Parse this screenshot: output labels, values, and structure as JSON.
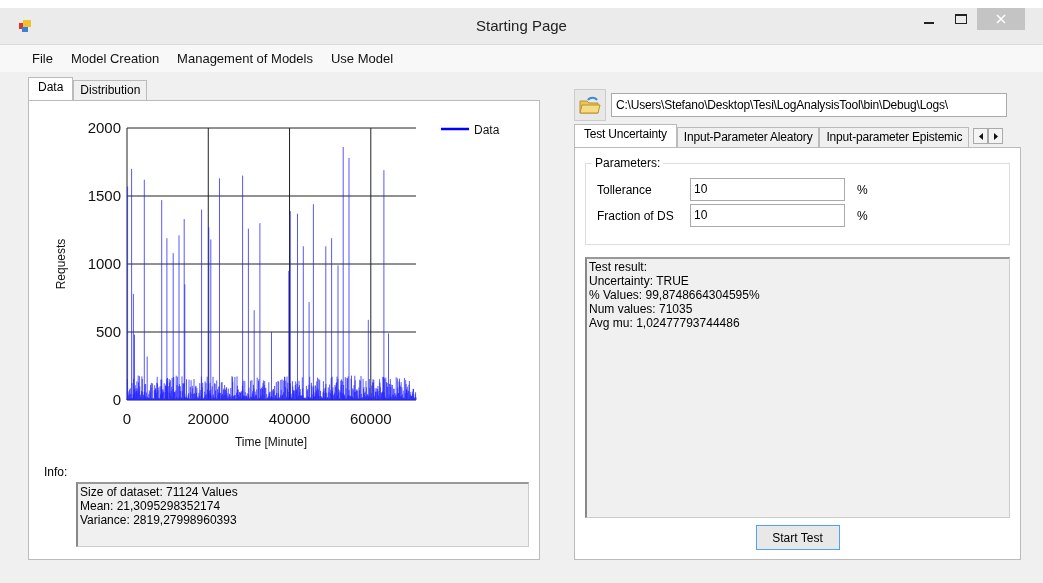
{
  "window": {
    "title": "Starting Page"
  },
  "menu": [
    {
      "label": "File"
    },
    {
      "label": "Model Creation"
    },
    {
      "label": "Management of Models"
    },
    {
      "label": "Use Model"
    }
  ],
  "left_tabs": [
    {
      "label": "Data",
      "selected": true
    },
    {
      "label": "Distribution",
      "selected": false
    }
  ],
  "chart": {
    "ylabel": "Requests",
    "xlabel": "Time [Minute]",
    "yticks": [
      "2000",
      "1500",
      "1000",
      "500",
      "0"
    ],
    "xticks": [
      "0",
      "20000",
      "40000",
      "60000"
    ],
    "legend": "Data"
  },
  "info": {
    "label": "Info:",
    "lines": [
      "Size of dataset: 71124 Values",
      "Mean: 21,3095298352174",
      "Variance: 2819,27998960393"
    ]
  },
  "path_field": {
    "value": "C:\\Users\\Stefano\\Desktop\\Tesi\\LogAnalysisTool\\bin\\Debug\\Logs\\"
  },
  "right_tabs": [
    {
      "label": "Test Uncertainty",
      "selected": true
    },
    {
      "label": "Input-Parameter Aleatory",
      "selected": false
    },
    {
      "label": "Input-parameter Epistemic",
      "selected": false
    }
  ],
  "parameters": {
    "title": "Parameters:",
    "fields": [
      {
        "label": "Tollerance",
        "value": "10",
        "unit": "%"
      },
      {
        "label": "Fraction of DS",
        "value": "10",
        "unit": "%"
      }
    ]
  },
  "result_lines": [
    "Test result:",
    "Uncertainty: TRUE",
    "% Values: 99,8748664304595%",
    "Num values: 71035",
    "Avg mu: 1,02477793744486"
  ],
  "start_button": "Start Test"
}
